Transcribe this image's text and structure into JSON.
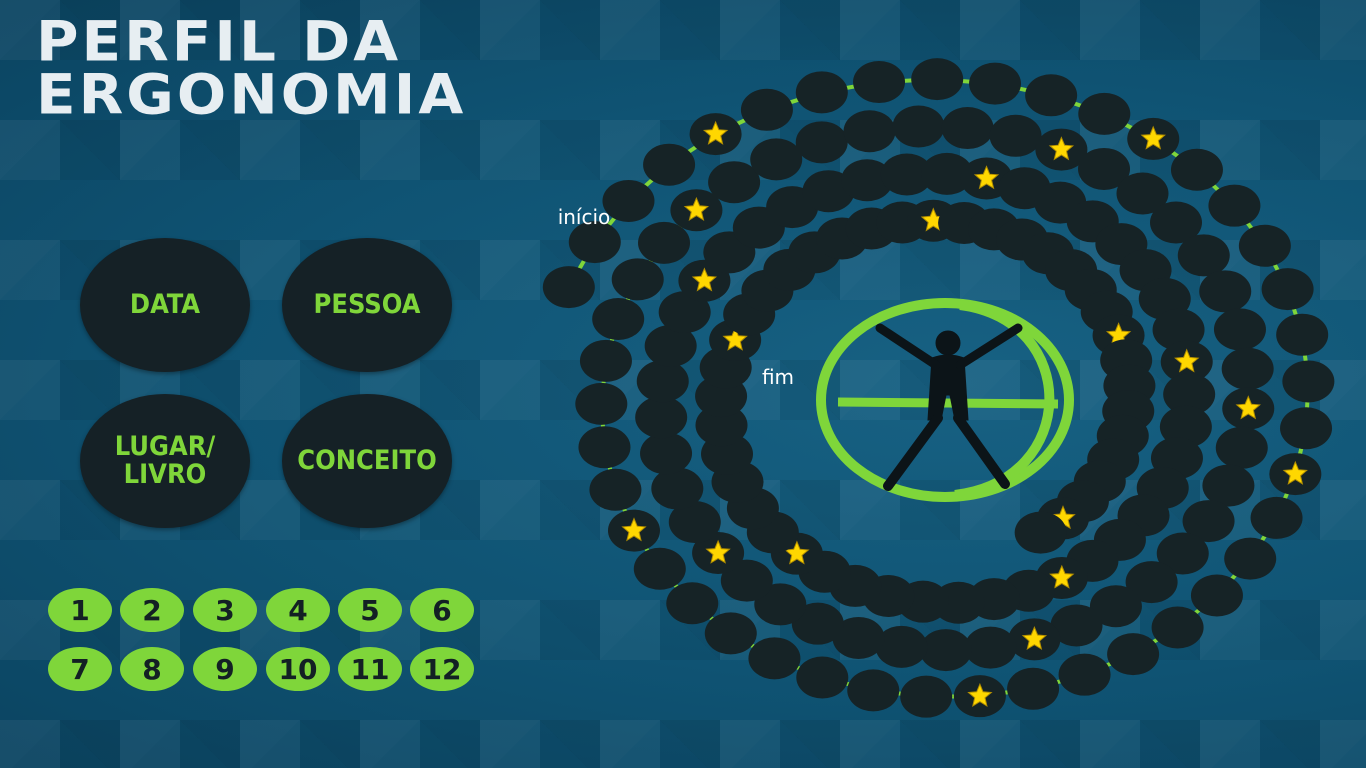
{
  "title": {
    "line1": "PERFIL DA",
    "line2": "ERGONOMIA"
  },
  "categories": [
    {
      "label": "DATA"
    },
    {
      "label": "PESSOA"
    },
    {
      "label": "LUGAR/\nLIVRO"
    },
    {
      "label": "CONCEITO"
    }
  ],
  "numbers": [
    "1",
    "2",
    "3",
    "4",
    "5",
    "6",
    "7",
    "8",
    "9",
    "10",
    "11",
    "12"
  ],
  "board": {
    "start_label": "início",
    "end_label": "fim",
    "space_color": "#162326",
    "path_color": "#7fd63a",
    "star_color": "#ffd700"
  },
  "logo": {
    "icon": "ergonomia-logo-icon",
    "color": "#7fd63a"
  },
  "colors": {
    "accent": "#7fd63a",
    "background": "#0f4f6e",
    "dark": "#152126"
  }
}
